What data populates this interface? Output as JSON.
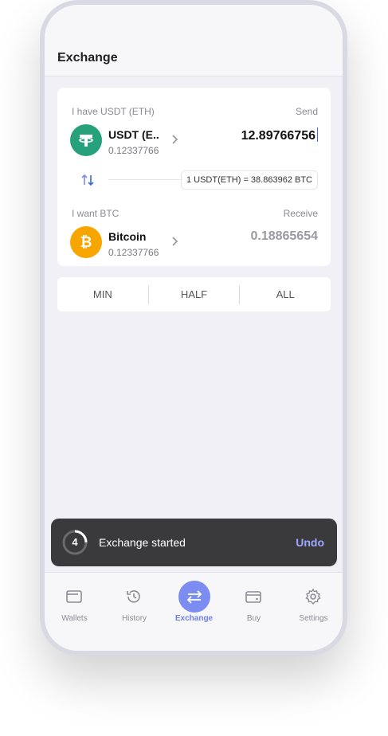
{
  "header": {
    "title": "Exchange"
  },
  "send": {
    "label": "I have USDT (ETH)",
    "side_label": "Send",
    "coin_name": "USDT (E..",
    "balance": "0.12337766",
    "amount": "12.89766756",
    "icon": "tether-icon",
    "color": "#26a17b"
  },
  "rate": {
    "text": "1 USDT(ETH) = 38.863962 BTC"
  },
  "receive": {
    "label": "I want BTC",
    "side_label": "Receive",
    "coin_name": "Bitcoin",
    "balance": "0.12337766",
    "amount": "0.18865654",
    "icon": "bitcoin-icon",
    "color": "#f7a600"
  },
  "quick": {
    "min": "MIN",
    "half": "HALF",
    "all": "ALL"
  },
  "snackbar": {
    "count": "4",
    "message": "Exchange started",
    "action": "Undo"
  },
  "tabs": [
    {
      "label": "Wallets",
      "icon": "wallet-icon"
    },
    {
      "label": "History",
      "icon": "history-icon"
    },
    {
      "label": "Exchange",
      "icon": "exchange-icon"
    },
    {
      "label": "Buy",
      "icon": "card-icon"
    },
    {
      "label": "Settings",
      "icon": "gear-icon"
    }
  ],
  "colors": {
    "accent": "#7c8cf0",
    "snackbar": "#3a3a3c",
    "undo": "#9ea8ff"
  }
}
